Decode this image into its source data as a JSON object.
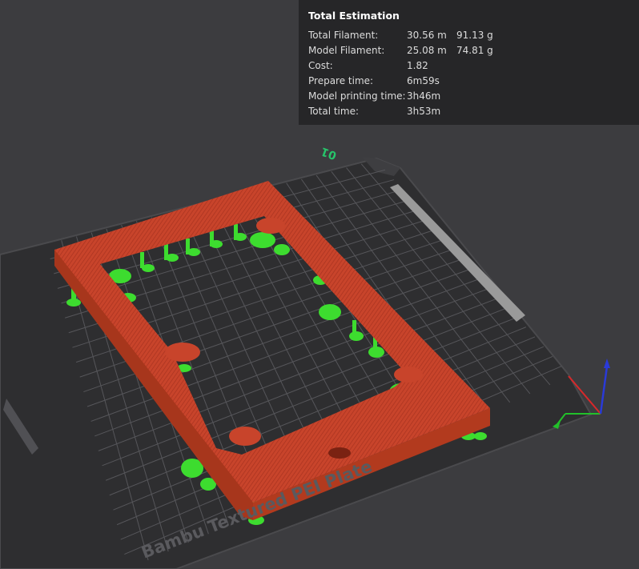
{
  "estimation": {
    "title": "Total Estimation",
    "rows": [
      {
        "label": "Total Filament:",
        "value": "30.56 m",
        "extra": "91.13 g"
      },
      {
        "label": "Model Filament:",
        "value": "25.08 m",
        "extra": "74.81 g"
      },
      {
        "label": "Cost:",
        "value": "1.82",
        "extra": ""
      },
      {
        "label": "Prepare time:",
        "value": "6m59s",
        "extra": ""
      },
      {
        "label": "Model printing time:",
        "value": "3h46m",
        "extra": ""
      },
      {
        "label": "Total time:",
        "value": "3h53m",
        "extra": ""
      }
    ]
  },
  "plate": {
    "number": "01",
    "name": "Bambu Textured PEI Plate"
  },
  "colors": {
    "background": "#3c3c3f",
    "bed": "#2f2f31",
    "grid": "#58585c",
    "model": "#c8442b",
    "support": "#3ddc2f",
    "plate_number": "#27c46a",
    "axis_x": "#d8282a",
    "axis_y": "#22c02a",
    "axis_z": "#2a3ad8"
  },
  "icons": [
    "axis-gizmo-icon"
  ]
}
